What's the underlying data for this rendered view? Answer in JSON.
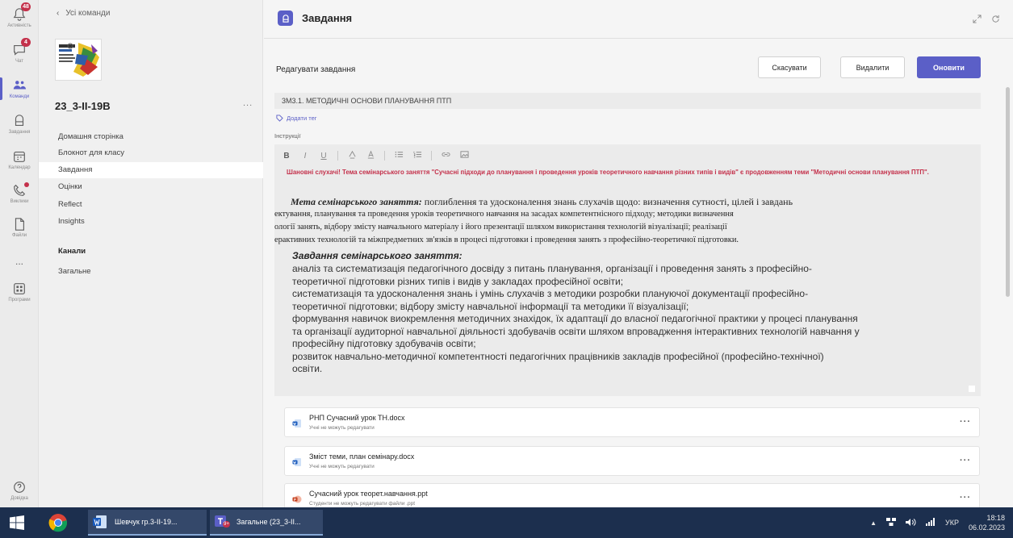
{
  "rail": {
    "items": [
      {
        "label": "Активність",
        "badge": "48"
      },
      {
        "label": "Чат",
        "badge": "4"
      },
      {
        "label": "Команди"
      },
      {
        "label": "Завдання"
      },
      {
        "label": "Календар"
      },
      {
        "label": "Виклики"
      },
      {
        "label": "Файли"
      },
      {
        "label": "..."
      },
      {
        "label": "Програми"
      },
      {
        "label": "Довідка"
      }
    ]
  },
  "sidebar": {
    "back_label": "Усі команди",
    "team_name": "23_3-ІІ-19В",
    "more": "...",
    "nav": [
      "Домашня сторінка",
      "Блокнот для класу",
      "Завдання",
      "Оцінки",
      "Reflect",
      "Insights"
    ],
    "channels_label": "Канали",
    "channels": [
      "Загальне"
    ]
  },
  "header": {
    "app_title": "Завдання"
  },
  "form": {
    "edit_title": "Редагувати завдання",
    "cancel": "Скасувати",
    "delete": "Видалити",
    "update": "Оновити",
    "assignment_title": "3М3.1. МЕТОДИЧНІ ОСНОВИ ПЛАНУВАННЯ ПТП",
    "add_tag": "Додати тег",
    "instructions_label": "Інструкції"
  },
  "editor": {
    "red_notice": "Шановні слухачі! Тема семінарського заняття \"Сучасні підходи до планування і проведення уроків теоретичного навчання різних типів і видів\" є продовженням теми \"Методичні основи планування ПТП\".",
    "goal_label": "Мета семінарського заняття:",
    "goal_line1": "поглиблення   та удосконалення знань слухачів щодо: визначення сутності,   цілей і завдань",
    "goal_line2": "ектування, планування та проведення уроків теоретичного навчання на засадах компетентнісного підходу;  методики визначення",
    "goal_line3": "ології занять, відбору змісту навчального матеріалу і його презентації шляхом використання технологій візуалізації; реалізації",
    "goal_line4": "ерактивних технологій та міжпредметних зв'язків в процесі підготовки і проведення занять з професійно-теоретичної підготовки.",
    "tasks_title": "Завдання семінарського заняття:",
    "tasks": [
      "аналіз та систематизація педагогічного досвіду з питань планування, організації і проведення занять з професійно-",
      "теоретичної підготовки різних типів і видів у закладах професійної освіти;",
      "систематизація та удосконалення знань і умінь слухачів з методики розробки плануючої документації професійно-",
      "теоретичної підготовки; відбору змісту навчальної інформації та методики її візуалізації;",
      "формування навичок виокремлення методичних знахідок, їх адаптації до власної педагогічної практики у процесі планування",
      "та організації аудиторної навчальної діяльності здобувачів освіти шляхом впровадження інтерактивних технологій навчання у",
      "професійну підготовку здобувачів освіти;",
      "розвиток навчально-методичної компетентності педагогічних працівників закладів професійної (професійно-технічної)",
      "освіти."
    ]
  },
  "attachments": [
    {
      "name": "РНП Сучасний урок ТН.docx",
      "note": "Учні не можуть редагувати",
      "type": "word"
    },
    {
      "name": "Зміст теми, план семінару.docx",
      "note": "Учні не можуть редагувати",
      "type": "word"
    },
    {
      "name": "Сучасний урок теорет.навчання.ppt",
      "note": "Студенти не можуть редагувати файли .ppt",
      "type": "ppt"
    }
  ],
  "taskbar": {
    "word_label": "Шевчук гр.3-ІІ-19...",
    "teams_label": "Загальне (23_3-ІІ...",
    "teams_badge": "9+",
    "lang": "УКР",
    "time": "18:18",
    "date": "06.02.2023"
  },
  "colors": {
    "accent": "#5b5fc7",
    "notice_red": "#c4314b",
    "taskbar": "#1c2f4e"
  }
}
